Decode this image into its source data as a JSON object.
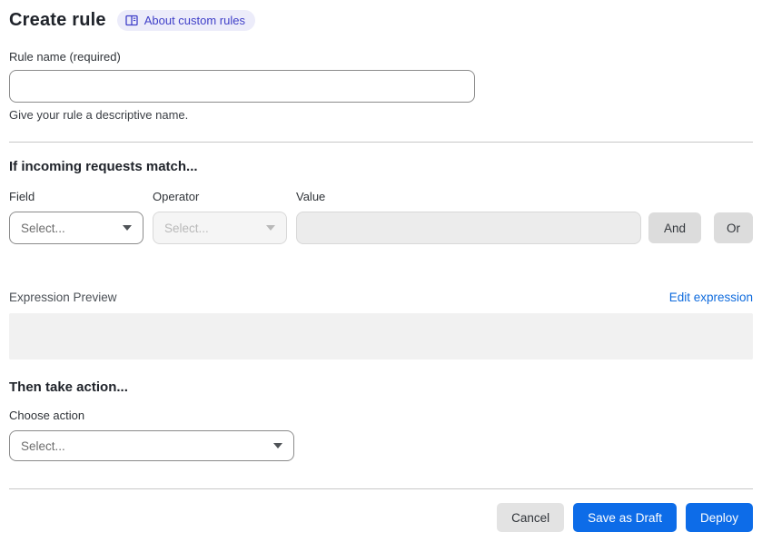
{
  "header": {
    "title": "Create rule",
    "about_badge_label": "About custom rules"
  },
  "rule_name": {
    "label": "Rule name (required)",
    "value": "",
    "helper": "Give your rule a descriptive name."
  },
  "match_section": {
    "heading": "If incoming requests match...",
    "field": {
      "label": "Field",
      "selected": "Select..."
    },
    "operator": {
      "label": "Operator",
      "selected": "Select..."
    },
    "value": {
      "label": "Value",
      "value": ""
    },
    "and_label": "And",
    "or_label": "Or"
  },
  "expression": {
    "label": "Expression Preview",
    "edit_link": "Edit expression",
    "content": ""
  },
  "action_section": {
    "heading": "Then take action...",
    "choose_label": "Choose action",
    "selected": "Select..."
  },
  "footer": {
    "cancel_label": "Cancel",
    "save_draft_label": "Save as Draft",
    "deploy_label": "Deploy"
  },
  "icons": {
    "about_icon": "book-icon",
    "select_caret": "chevron-down-icon"
  },
  "colors": {
    "primary_blue": "#0d6ce8",
    "link_blue": "#0f6bdd",
    "badge_bg": "#ececfa",
    "badge_text": "#3f3fc8",
    "disabled_bg": "#f5f5f5",
    "preview_bg": "#f1f1f1",
    "secondary_btn_bg": "#e3e3e3"
  }
}
